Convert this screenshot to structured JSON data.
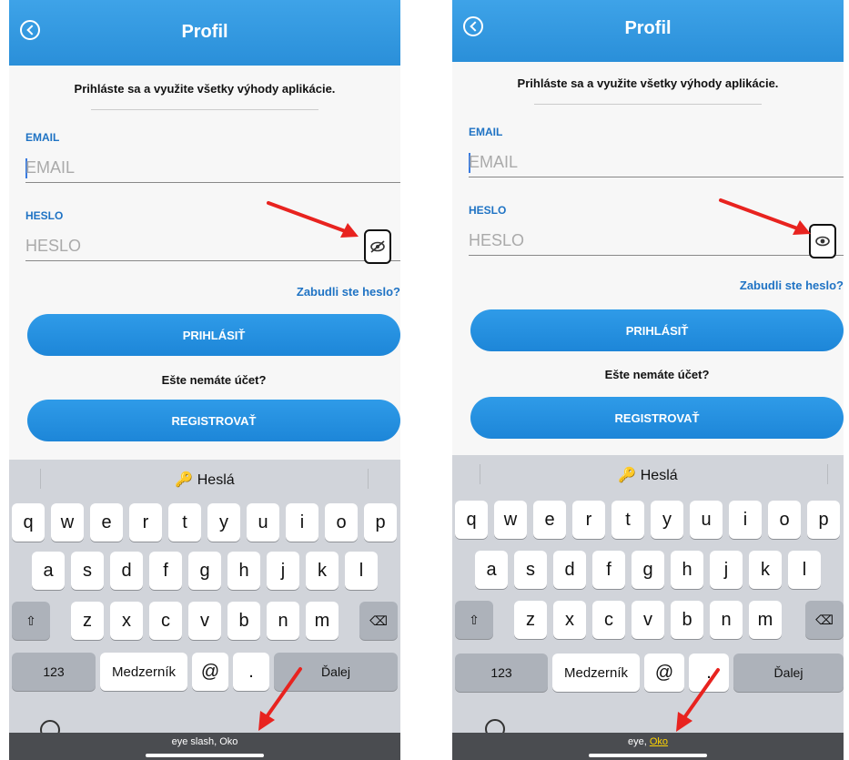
{
  "screens": [
    {
      "header": {
        "title": "Profil"
      },
      "subtitle": "Prihláste sa a využite všetky výhody aplikácie.",
      "email": {
        "label": "EMAIL",
        "placeholder": "EMAIL"
      },
      "password": {
        "label": "HESLO",
        "placeholder": "HESLO",
        "visibility_icon": "eye-slash-icon"
      },
      "forgot": "Zabudli ste heslo?",
      "login_button": "PRIHLÁSIŤ",
      "no_account": "Ešte nemáte účet?",
      "register_button": "REGISTROVAŤ",
      "keyboard": {
        "suggestion": "Heslá",
        "row1": [
          "q",
          "w",
          "e",
          "r",
          "t",
          "y",
          "u",
          "i",
          "o",
          "p"
        ],
        "row2": [
          "a",
          "s",
          "d",
          "f",
          "g",
          "h",
          "j",
          "k",
          "l"
        ],
        "row3": [
          "z",
          "x",
          "c",
          "v",
          "b",
          "n",
          "m"
        ],
        "numbers": "123",
        "space": "Medzerník",
        "at": "@",
        "dot": ".",
        "return": "Ďalej"
      },
      "voiceover": {
        "prefix": "eye slash, ",
        "highlight": "Oko"
      }
    },
    {
      "header": {
        "title": "Profil"
      },
      "subtitle": "Prihláste sa a využite všetky výhody aplikácie.",
      "email": {
        "label": "EMAIL",
        "placeholder": "EMAIL"
      },
      "password": {
        "label": "HESLO",
        "placeholder": "HESLO",
        "visibility_icon": "eye-icon"
      },
      "forgot": "Zabudli ste heslo?",
      "login_button": "PRIHLÁSIŤ",
      "no_account": "Ešte nemáte účet?",
      "register_button": "REGISTROVAŤ",
      "keyboard": {
        "suggestion": "Heslá",
        "row1": [
          "q",
          "w",
          "e",
          "r",
          "t",
          "y",
          "u",
          "i",
          "o",
          "p"
        ],
        "row2": [
          "a",
          "s",
          "d",
          "f",
          "g",
          "h",
          "j",
          "k",
          "l"
        ],
        "row3": [
          "z",
          "x",
          "c",
          "v",
          "b",
          "n",
          "m"
        ],
        "numbers": "123",
        "space": "Medzerník",
        "at": "@",
        "dot": ".",
        "return": "Ďalej"
      },
      "voiceover": {
        "prefix": "eye, ",
        "highlight": "Oko"
      }
    }
  ],
  "colors": {
    "accent": "#2a8fd9",
    "link": "#1f73c4",
    "arrow": "#e8231f",
    "voiceover_highlight": "#ffd400"
  }
}
